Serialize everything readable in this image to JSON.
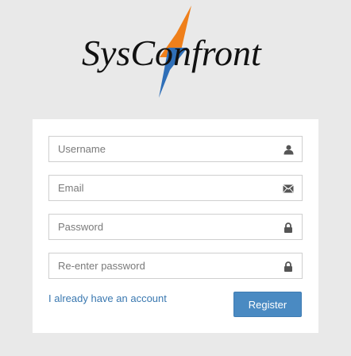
{
  "brand": {
    "name": "SysConfront",
    "colors": {
      "orange": "#ef7f1a",
      "blue": "#2f6fb8",
      "text": "#111111"
    }
  },
  "form": {
    "username": {
      "placeholder": "Username",
      "value": "",
      "icon": "user-icon"
    },
    "email": {
      "placeholder": "Email",
      "value": "",
      "icon": "envelope-icon"
    },
    "password": {
      "placeholder": "Password",
      "value": "",
      "icon": "lock-icon"
    },
    "confirm_password": {
      "placeholder": "Re-enter password",
      "value": "",
      "icon": "lock-icon"
    },
    "login_link_label": "I already have an account",
    "register_label": "Register"
  },
  "colors": {
    "page_background": "#e9e9e9",
    "panel_background": "#ffffff",
    "button_background": "#4a8ac2",
    "link": "#3a78b0"
  }
}
